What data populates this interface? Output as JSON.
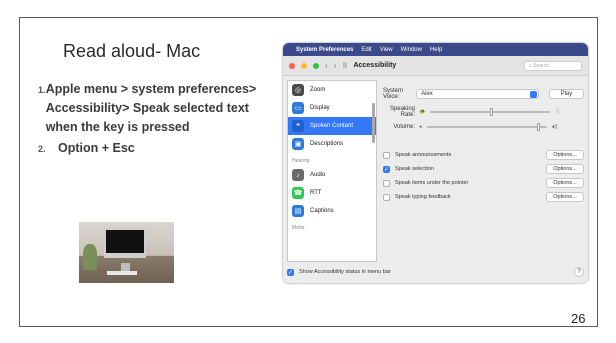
{
  "slide": {
    "title": "Read aloud- Mac",
    "page_number": "26",
    "steps": [
      {
        "num": "1.",
        "text": "Apple menu > system preferences> Accessibility> Speak selected text when the key is pressed"
      },
      {
        "num": "2.",
        "text": "Option + Esc"
      }
    ]
  },
  "mac": {
    "menubar": {
      "app": "System Preferences",
      "items": [
        "Edit",
        "View",
        "Window",
        "Help"
      ]
    },
    "toolbar": {
      "title": "Accessibility",
      "search_placeholder": "Search"
    },
    "sidebar": {
      "items": [
        {
          "label": "Zoom",
          "icon": "zoom-icon",
          "color": "#4a4a4a"
        },
        {
          "label": "Display",
          "icon": "display-icon",
          "color": "#2f7bd9"
        },
        {
          "label": "Spoken Content",
          "icon": "speech-icon",
          "color": "#2f7bd9",
          "selected": true
        },
        {
          "label": "Descriptions",
          "icon": "descriptions-icon",
          "color": "#2f7bd9"
        }
      ],
      "hearing_label": "Hearing",
      "hearing_items": [
        {
          "label": "Audio",
          "icon": "audio-icon",
          "color": "#6b6b6b"
        },
        {
          "label": "RTT",
          "icon": "rtt-icon",
          "color": "#34c759"
        },
        {
          "label": "Captions",
          "icon": "captions-icon",
          "color": "#2f7bd9"
        }
      ],
      "motor_label": "Motor"
    },
    "content": {
      "voice_label": "System Voice:",
      "voice_value": "Alex",
      "play_label": "Play",
      "rate_label": "Speaking Rate:",
      "volume_label": "Volume:",
      "rate_level": 0.5,
      "volume_level": 0.92,
      "options": [
        {
          "label": "Speak announcements",
          "checked": false,
          "button": "Options..."
        },
        {
          "label": "Speak selection",
          "checked": true,
          "button": "Options..."
        },
        {
          "label": "Speak items under the pointer",
          "checked": false,
          "button": "Options..."
        },
        {
          "label": "Speak typing feedback",
          "checked": false,
          "button": "Options..."
        }
      ]
    },
    "footer": {
      "status_label": "Show Accessibility status in menu bar",
      "status_checked": true,
      "help": "?"
    }
  }
}
